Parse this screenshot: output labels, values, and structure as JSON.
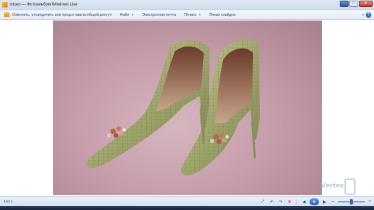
{
  "window": {
    "title": "shoes — Фотоальбом Windows Live",
    "buttons": {
      "minimize": "–",
      "maximize": "□",
      "close": "✕"
    }
  },
  "cmdbar": {
    "share_label": "Изменить, упорядочить или предоставить общий доступ",
    "file_label": "Файл",
    "email_label": "Электронная почта",
    "print_label": "Печать",
    "slideshow_label": "Показ слайдов",
    "help_label": "?"
  },
  "photo": {
    "subject": "pair of green crocodile-textured high-heel shoes with bejeweled brooch on pink background"
  },
  "watermark": {
    "brand": "Vertex",
    "sub": ""
  },
  "status": {
    "counter": "1 из 1",
    "zoom_value": 0.5
  },
  "colors": {
    "accent": "#2d5fae",
    "background_photo": "#c79eab",
    "shoe": "#a9ad76",
    "close": "#c43d2a"
  }
}
